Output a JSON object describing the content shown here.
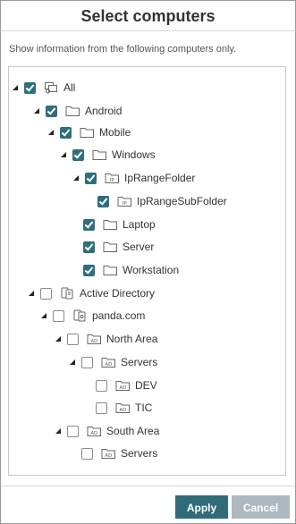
{
  "dialog": {
    "title": "Select computers",
    "subtitle": "Show information from the following computers only."
  },
  "tree": [
    {
      "label": "All",
      "checked": true,
      "expandable": true,
      "icon": "computers-group-icon"
    },
    {
      "label": "Android",
      "checked": true,
      "expandable": true,
      "icon": "folder-icon"
    },
    {
      "label": "Mobile",
      "checked": true,
      "expandable": true,
      "icon": "folder-icon"
    },
    {
      "label": "Windows",
      "checked": true,
      "expandable": true,
      "icon": "folder-icon"
    },
    {
      "label": "IpRangeFolder",
      "checked": true,
      "expandable": true,
      "icon": "ip-folder-icon"
    },
    {
      "label": "IpRangeSubFolder",
      "checked": true,
      "expandable": false,
      "icon": "ip-folder-icon"
    },
    {
      "label": "Laptop",
      "checked": true,
      "expandable": false,
      "icon": "folder-icon"
    },
    {
      "label": "Server",
      "checked": true,
      "expandable": false,
      "icon": "folder-icon"
    },
    {
      "label": "Workstation",
      "checked": true,
      "expandable": false,
      "icon": "folder-icon"
    },
    {
      "label": "Active Directory",
      "checked": false,
      "expandable": true,
      "icon": "active-directory-icon"
    },
    {
      "label": "panda.com",
      "checked": false,
      "expandable": true,
      "icon": "domain-icon"
    },
    {
      "label": "North Area",
      "checked": false,
      "expandable": true,
      "icon": "ad-folder-icon"
    },
    {
      "label": "Servers",
      "checked": false,
      "expandable": true,
      "icon": "ad-folder-icon"
    },
    {
      "label": "DEV",
      "checked": false,
      "expandable": false,
      "icon": "ad-folder-icon"
    },
    {
      "label": "TIC",
      "checked": false,
      "expandable": false,
      "icon": "ad-folder-icon"
    },
    {
      "label": "South Area",
      "checked": false,
      "expandable": true,
      "icon": "ad-folder-icon"
    },
    {
      "label": "Servers",
      "checked": false,
      "expandable": false,
      "icon": "ad-folder-icon"
    }
  ],
  "icon_text": {
    "ip": "IP",
    "ad": "AD"
  },
  "buttons": {
    "apply": "Apply",
    "cancel": "Cancel"
  },
  "colors": {
    "accent": "#2f6b78",
    "checkbox": "#2e6e7d",
    "cancel": "#aeb8c0"
  }
}
